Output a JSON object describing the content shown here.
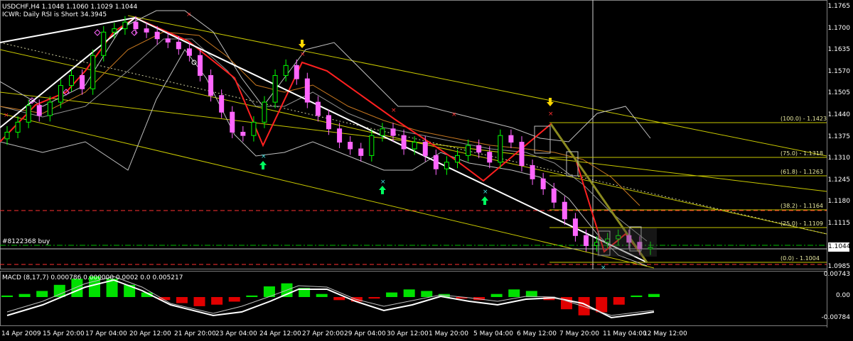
{
  "header": {
    "symbol_line": "USDCHF,H4  1.1048 1.1060 1.1029 1.1044",
    "indicator_line": "ICWR: Daily RSI is Short 34.3945"
  },
  "order_label": "#8122368 buy",
  "macd_label": "MACD  (8,17,7) 0.000786 0.000000 0.0002 0.0 0.005217",
  "current_price": "1.1044",
  "price_ticks": [
    "1.1765",
    "1.1700",
    "1.1635",
    "1.1570",
    "1.1505",
    "1.1440",
    "1.1375",
    "1.1310",
    "1.1245",
    "1.1180",
    "1.1115",
    "1.0985"
  ],
  "macd_ticks": [
    "0.00743",
    "0.00",
    "-0.00784"
  ],
  "fibo_levels": [
    {
      "label": "(100.0) - 1.1423"
    },
    {
      "label": "(75.0) - 1.1318"
    },
    {
      "label": "(61.8) - 1.1263"
    },
    {
      "label": "(38.2) - 1.1164"
    },
    {
      "label": "(25.0) - 1.1109"
    },
    {
      "label": "(0.0) - 1.1004"
    }
  ],
  "dates": [
    "14 Apr 2009",
    "15 Apr 20:00",
    "17 Apr 04:00",
    "20 Apr 12:00",
    "21 Apr 20:00",
    "23 Apr 04:00",
    "24 Apr 12:00",
    "27 Apr 20:00",
    "29 Apr 04:00",
    "30 Apr 12:00",
    "1 May 20:00",
    "5 May 04:00",
    "6 May 12:00",
    "7 May 20:00",
    "11 May 04:00",
    "12 May 12:00"
  ],
  "colors": {
    "bull_candle": "#00ff00",
    "bear_candle": "#ff66ff",
    "zigzag": "#ff2020",
    "channel": "#c8c800",
    "bands": "#c0c0c0",
    "ma": "#c87820",
    "macd_pos": "#00e000",
    "macd_neg": "#e00000"
  },
  "chart_data": {
    "type": "line",
    "title": "USDCHF,H4",
    "ylim": [
      1.0985,
      1.1765
    ],
    "candles_close_approx": [
      1.139,
      1.142,
      1.147,
      1.144,
      1.148,
      1.153,
      1.156,
      1.152,
      1.162,
      1.169,
      1.17,
      1.172,
      1.17,
      1.169,
      1.167,
      1.166,
      1.164,
      1.162,
      1.156,
      1.15,
      1.145,
      1.139,
      1.138,
      1.142,
      1.148,
      1.156,
      1.159,
      1.155,
      1.148,
      1.144,
      1.14,
      1.136,
      1.134,
      1.132,
      1.138,
      1.14,
      1.138,
      1.134,
      1.136,
      1.132,
      1.128,
      1.13,
      1.132,
      1.135,
      1.133,
      1.13,
      1.138,
      1.136,
      1.129,
      1.125,
      1.122,
      1.118,
      1.113,
      1.108,
      1.105,
      1.106,
      1.107,
      1.108,
      1.106,
      1.104,
      1.1044
    ],
    "macd_histogram_approx": [
      0.0005,
      0.001,
      0.002,
      0.004,
      0.006,
      0.0068,
      0.006,
      0.004,
      0.0015,
      -0.001,
      -0.002,
      -0.003,
      -0.0025,
      -0.0015,
      0.0005,
      0.0035,
      0.0045,
      0.003,
      0.001,
      -0.001,
      -0.0015,
      -0.0005,
      0.0015,
      0.0025,
      0.002,
      0.001,
      -0.0005,
      -0.001,
      0.001,
      0.0025,
      0.002,
      -0.001,
      -0.004,
      -0.006,
      -0.005,
      -0.0025,
      0.0005,
      0.001
    ]
  }
}
